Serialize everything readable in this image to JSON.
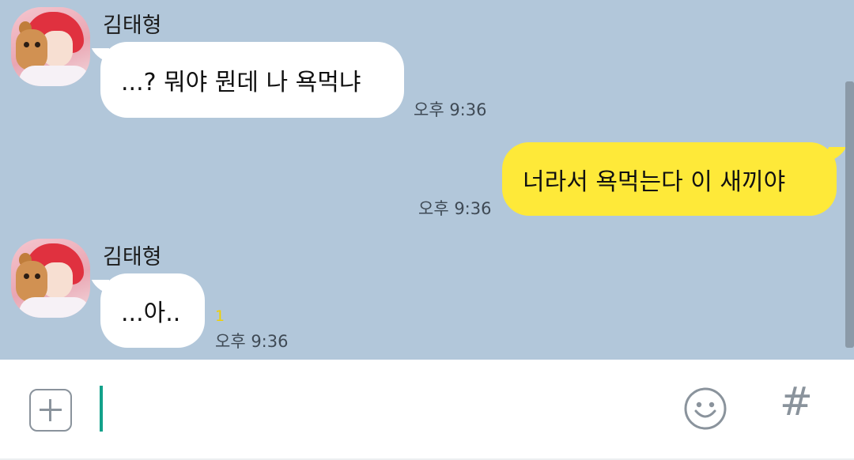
{
  "messages": [
    {
      "side": "left",
      "sender": "김태형",
      "text": "...? 뭐야 뭔데 나 욕먹냐",
      "time": "오후 9:36"
    },
    {
      "side": "right",
      "text": "너라서 욕먹는다 이 새끼야",
      "time": "오후 9:36"
    },
    {
      "side": "left",
      "sender": "김태형",
      "text": "...아..",
      "time": "오후 9:36",
      "unread": "1"
    }
  ],
  "input": {
    "placeholder": ""
  },
  "icons": {
    "attach": "plus-square-icon",
    "emoji": "smiley-icon",
    "hashtag": "hashtag-icon"
  },
  "colors": {
    "background": "#b2c7da",
    "incoming_bubble": "#ffffff",
    "outgoing_bubble": "#fee939",
    "caret": "#12a18a",
    "unread": "#f0d000"
  }
}
